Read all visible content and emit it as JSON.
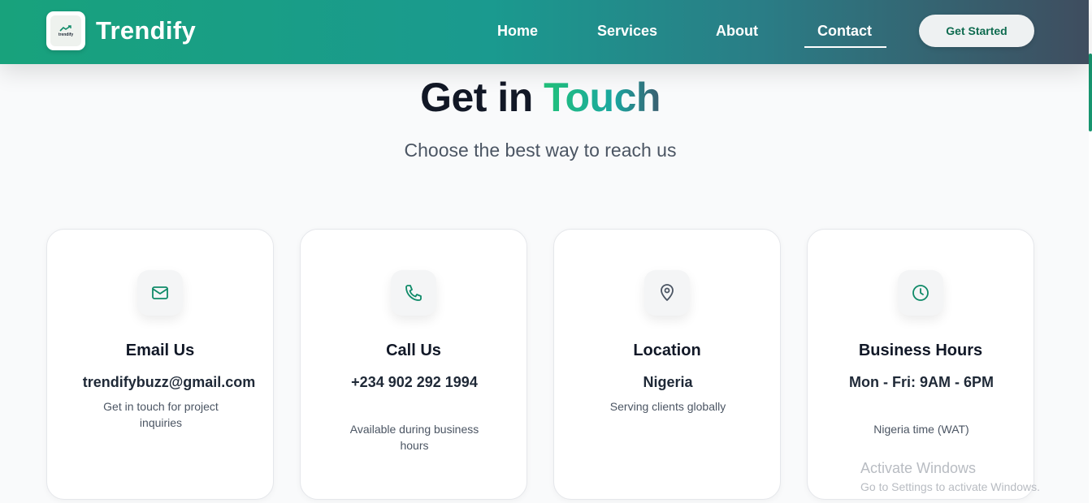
{
  "header": {
    "logo_text": "trendify",
    "brand": "Trendify",
    "nav": {
      "home": "Home",
      "services": "Services",
      "about": "About",
      "contact": "Contact"
    },
    "active": "Contact",
    "cta": "Get Started"
  },
  "hero": {
    "title_main": "Get in",
    "title_accent": "Touch",
    "subtitle": "Choose the best way to reach us"
  },
  "cards": [
    {
      "icon": "mail-icon",
      "title": "Email Us",
      "value": "trendifybuzz@gmail.com",
      "note": "Get in touch for project inquiries"
    },
    {
      "icon": "phone-icon",
      "title": "Call Us",
      "value": "+234 902 292 1994",
      "note": "Available during business hours"
    },
    {
      "icon": "map-pin-icon",
      "title": "Location",
      "value": "Nigeria",
      "note": "Serving clients globally"
    },
    {
      "icon": "clock-icon",
      "title": "Business Hours",
      "value": "Mon - Fri: 9AM - 6PM",
      "note": "Nigeria time (WAT)"
    }
  ],
  "watermark": {
    "title": "Activate Windows",
    "subtitle": "Go to Settings to activate Windows."
  },
  "colors": {
    "accent_green": "#18a27c",
    "icon_green": "#0f8a68",
    "icon_gray": "#4b5563"
  }
}
